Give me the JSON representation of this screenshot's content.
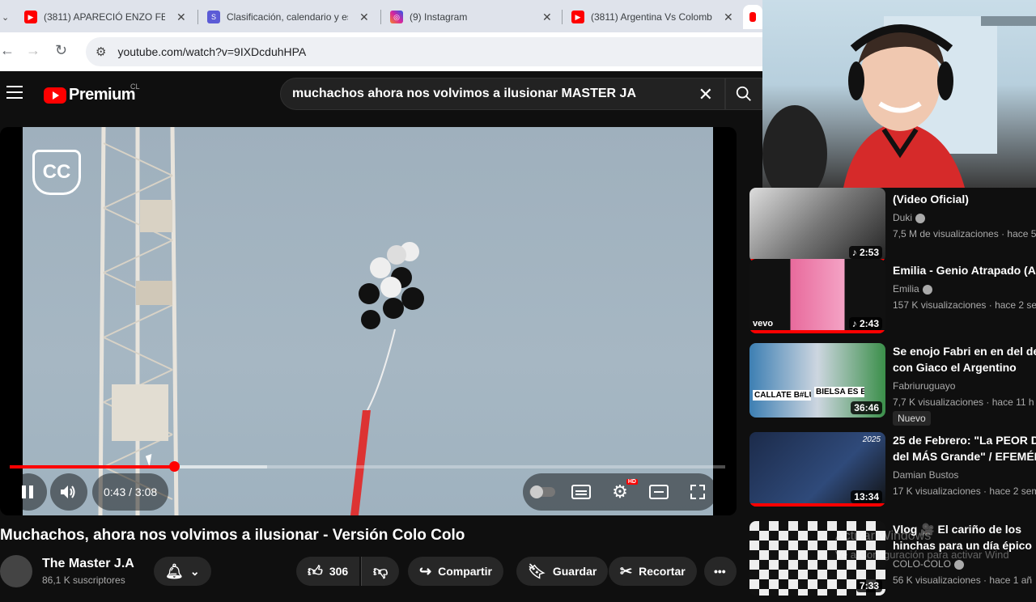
{
  "browser": {
    "tabs": [
      {
        "title": "(3811) APARECIÓ ENZO FER",
        "icon": "youtube-icon",
        "color": "#ff0000"
      },
      {
        "title": "Clasificación, calendario y es",
        "icon": "site-icon",
        "color": "#5b5bd6"
      },
      {
        "title": "(9) Instagram",
        "icon": "instagram-icon",
        "color": "#d6249f"
      },
      {
        "title": "(3811) Argentina Vs Colomb",
        "icon": "youtube-icon",
        "color": "#ff0000"
      }
    ],
    "url": "youtube.com/watch?v=9IXDcduhHPA"
  },
  "header": {
    "logo": "Premium",
    "country": "CL",
    "search_query": "muchachos ahora nos volvimos a ilusionar MASTER JA"
  },
  "player": {
    "channel_badge": "CC",
    "time": "0:43 / 3:08",
    "progress_fraction": 0.23,
    "buffered_fraction": 0.36,
    "hd_badge": "HD"
  },
  "video": {
    "title": "Muchachos, ahora nos volvimos a ilusionar - Versión Colo Colo",
    "channel": "The Master J.A",
    "subscribers": "86,1 K suscriptores",
    "likes": "306",
    "share_label": "Compartir",
    "save_label": "Guardar",
    "clip_label": "Recortar"
  },
  "sidebar": {
    "items": [
      {
        "title": "(Video Oficial)",
        "channel": "Duki",
        "meta": "7,5 M de visualizaciones · hace 5",
        "duration": "2:53",
        "music": true
      },
      {
        "title": "Emilia - Genio Atrapado (Au",
        "channel": "Emilia",
        "meta": "157 K visualizaciones · hace 2 se",
        "duration": "2:43",
        "music": true,
        "thumb_label": "vevo"
      },
      {
        "title": "Se enojo Fabri en en del deb",
        "title2": "con Giaco el Argentino",
        "channel": "Fabriuruguayo",
        "meta": "7,7 K visualizaciones · hace 11 h",
        "duration": "36:46",
        "badge": "Nuevo",
        "thumb_text1": "CALLATE B#LUDO",
        "thumb_text2": "BIELSA ES EL MEJOR"
      },
      {
        "title": "25 de Febrero: \"La PEOR Der",
        "title2": "del MÁS Grande\" / EFEMÉRI",
        "channel": "Damian Bustos",
        "meta": "17 K visualizaciones · hace 2 sem",
        "duration": "13:34",
        "thumb_text1": "2025"
      },
      {
        "title": "Vlog 🎥 El cariño de los",
        "title2": "hinchas para un día épico",
        "channel": "COLO-COLO",
        "meta": "56 K visualizaciones · hace 1 añ",
        "duration": "7:33"
      }
    ]
  },
  "overlay": {
    "watermark_line1": "Activar Windows",
    "watermark_line2": "Ve a Configuración para activar Wind"
  }
}
